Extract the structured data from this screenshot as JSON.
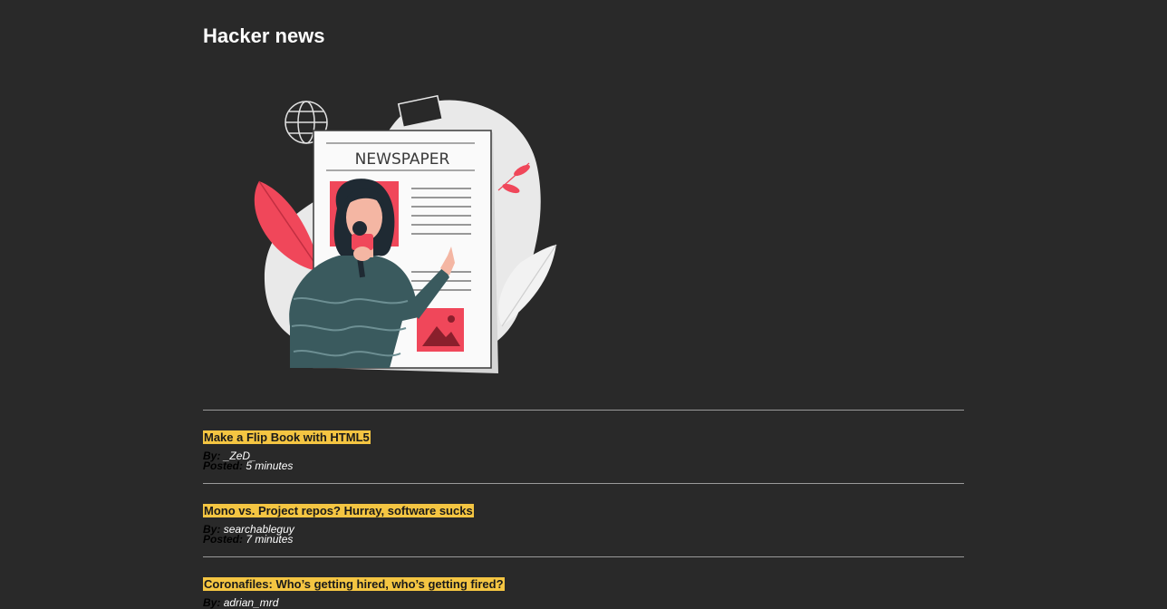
{
  "page": {
    "title": "Hacker news"
  },
  "colors": {
    "background": "#292929",
    "highlight": "#f4c542",
    "accent": "#f0475a"
  },
  "illustration": {
    "newspaper_heading": "NEWSPAPER"
  },
  "meta_labels": {
    "by": "By:",
    "posted": "Posted:"
  },
  "stories": [
    {
      "title": "Make a Flip Book with HTML5",
      "author": "_ZeD_",
      "posted": "5 minutes"
    },
    {
      "title": "Mono vs. Project repos? Hurray, software sucks",
      "author": "searchableguy",
      "posted": "7 minutes"
    },
    {
      "title": "Coronafiles: Who’s getting hired, who’s getting fired?",
      "author": "adrian_mrd",
      "posted": ""
    }
  ]
}
